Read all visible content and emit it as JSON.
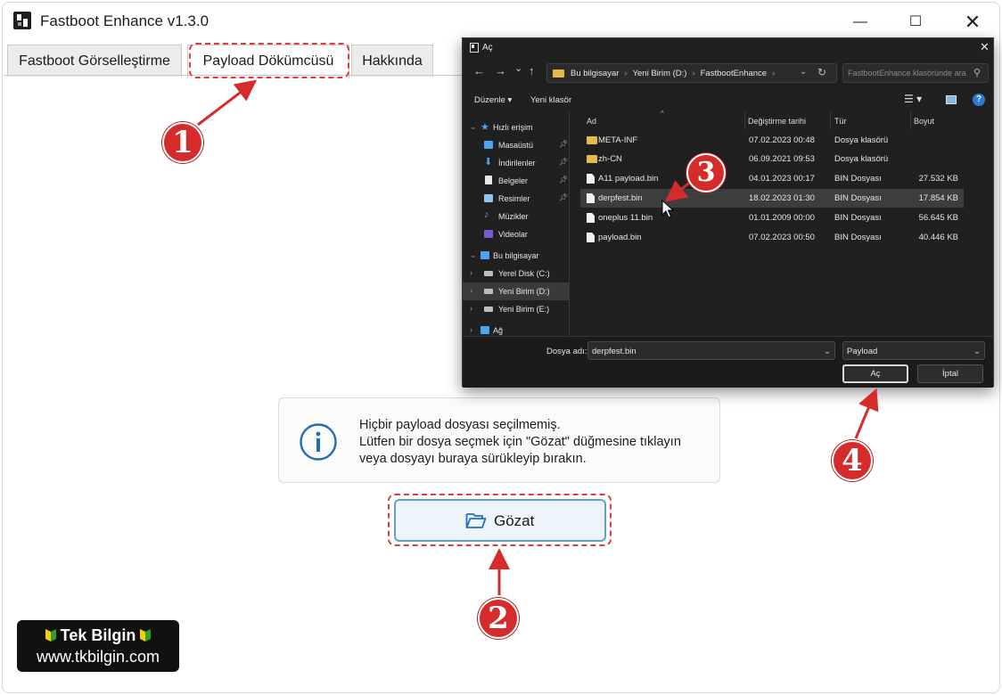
{
  "app": {
    "title": "Fastboot Enhance v1.3.0",
    "controls": {
      "minimize": "—",
      "maximize": "☐",
      "close": "✕"
    }
  },
  "tabs": [
    {
      "label": "Fastboot Görselleştirme",
      "active": false
    },
    {
      "label": "Payload Dökümcüsü",
      "active": true
    },
    {
      "label": "Hakkında",
      "active": false
    }
  ],
  "info": {
    "icon": "info-icon",
    "lines": [
      "Hiçbir payload dosyası seçilmemiş.",
      "Lütfen bir dosya seçmek için \"Gözat\" düğmesine tıklayın",
      "veya dosyayı buraya sürükleyip bırakın."
    ]
  },
  "browse_button": {
    "label": "Gözat",
    "icon": "folder-open-icon"
  },
  "watermark": {
    "line1": "Tek Bilgin",
    "line2": "www.tkbilgin.com"
  },
  "markers": [
    "1",
    "2",
    "3",
    "4"
  ],
  "dialog": {
    "title": "Aç",
    "close": "✕",
    "nav": {
      "back": "←",
      "forward": "→",
      "down": "⌄",
      "up": "↑"
    },
    "breadcrumb": [
      "Bu bilgisayar",
      "Yeni Birim (D:)",
      "FastbootEnhance"
    ],
    "search_placeholder": "FastbootEnhance klasöründe ara",
    "toolbar": {
      "organize": "Düzenle ▾",
      "new_folder": "Yeni klasör",
      "view": "☰ ▾",
      "help": "?"
    },
    "sidebar": [
      {
        "label": "Hızlı erişim",
        "icon": "star-icon",
        "pinned": false,
        "selected": false
      },
      {
        "label": "Masaüstü",
        "icon": "desktop-icon",
        "pinned": true,
        "selected": false
      },
      {
        "label": "İndirilenler",
        "icon": "download-icon",
        "pinned": true,
        "selected": false
      },
      {
        "label": "Belgeler",
        "icon": "documents-icon",
        "pinned": true,
        "selected": false
      },
      {
        "label": "Resimler",
        "icon": "pictures-icon",
        "pinned": true,
        "selected": false
      },
      {
        "label": "Müzikler",
        "icon": "music-icon",
        "pinned": false,
        "selected": false
      },
      {
        "label": "Videolar",
        "icon": "videos-icon",
        "pinned": false,
        "selected": false
      },
      {
        "label": "Bu bilgisayar",
        "icon": "computer-icon",
        "pinned": false,
        "selected": false
      },
      {
        "label": "Yerel Disk (C:)",
        "icon": "drive-icon",
        "pinned": false,
        "selected": false
      },
      {
        "label": "Yeni Birim (D:)",
        "icon": "drive-icon",
        "pinned": false,
        "selected": true
      },
      {
        "label": "Yeni Birim (E:)",
        "icon": "drive-icon",
        "pinned": false,
        "selected": false
      },
      {
        "label": "Ağ",
        "icon": "network-icon",
        "pinned": false,
        "selected": false
      }
    ],
    "columns": [
      "Ad",
      "Değiştirme tarihi",
      "Tür",
      "Boyut"
    ],
    "files": [
      {
        "name": "META-INF",
        "date": "07.02.2023 00:48",
        "type": "Dosya klasörü",
        "size": "",
        "kind": "folder",
        "selected": false
      },
      {
        "name": "zh-CN",
        "date": "06.09.2021 09:53",
        "type": "Dosya klasörü",
        "size": "",
        "kind": "folder",
        "selected": false
      },
      {
        "name": "A11 payload.bin",
        "date": "04.01.2023 00:17",
        "type": "BIN Dosyası",
        "size": "27.532 KB",
        "kind": "file",
        "selected": false
      },
      {
        "name": "derpfest.bin",
        "date": "18.02.2023 01:30",
        "type": "BIN Dosyası",
        "size": "17.854 KB",
        "kind": "file",
        "selected": true
      },
      {
        "name": "oneplus 11.bin",
        "date": "01.01.2009 00:00",
        "type": "BIN Dosyası",
        "size": "56.645 KB",
        "kind": "file",
        "selected": false
      },
      {
        "name": "payload.bin",
        "date": "07.02.2023 00:50",
        "type": "BIN Dosyası",
        "size": "40.446 KB",
        "kind": "file",
        "selected": false
      }
    ],
    "filename_label": "Dosya adı:",
    "filename_value": "derpfest.bin",
    "filetype": "Payload",
    "open_button": "Aç",
    "cancel_button": "İptal"
  },
  "colors": {
    "accent_red": "#d52b2b",
    "dialog_bg": "#202020",
    "button_border": "#6b9dc2"
  }
}
